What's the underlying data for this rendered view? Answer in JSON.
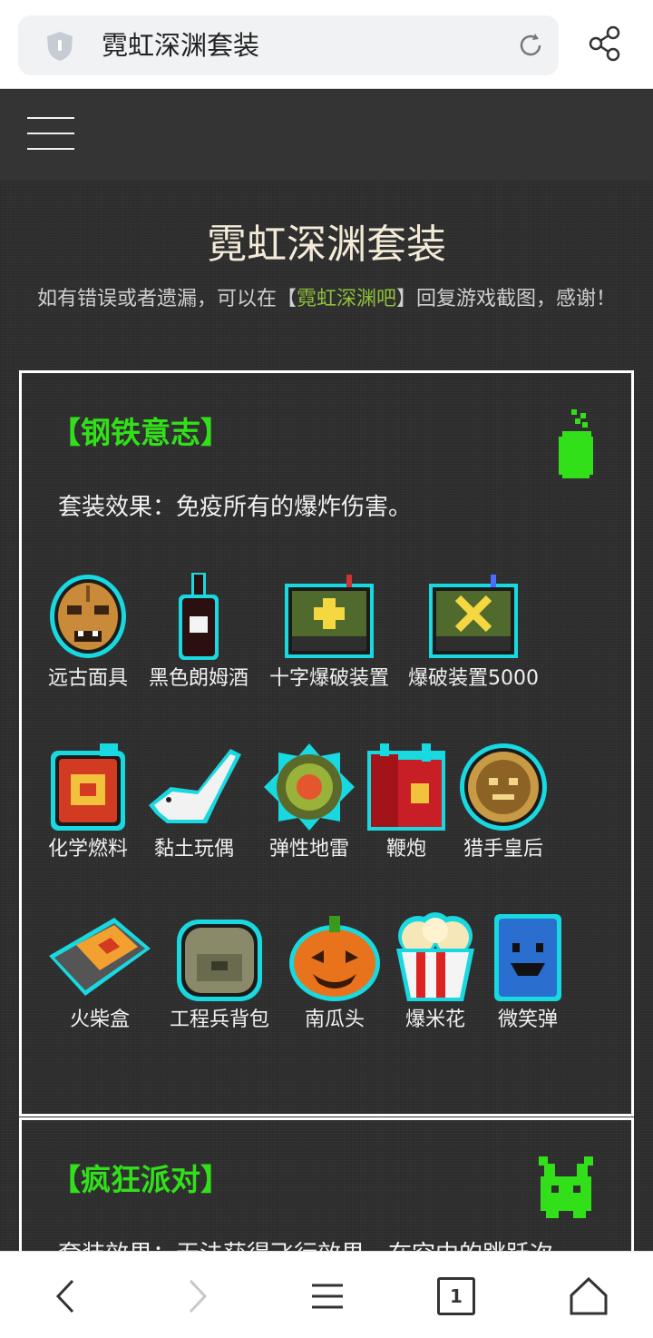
{
  "browser": {
    "url_title": "霓虹深渊套装",
    "icons": {
      "security": "shield-icon",
      "reload": "reload-icon",
      "share": "share-icon"
    }
  },
  "site_header": {
    "menu_icon": "hamburger-icon"
  },
  "page": {
    "title": "霓虹深渊套装",
    "notice_prefix": "如有错误或者遗漏，可以在【",
    "notice_link": "霓虹深渊吧",
    "notice_suffix": "】回复游戏截图，感谢！"
  },
  "sets": [
    {
      "title": "【钢铁意志】",
      "effect": "套装效果：免疫所有的爆炸伤害。",
      "items": [
        {
          "label": "远古面具"
        },
        {
          "label": "黑色朗姆酒"
        },
        {
          "label": "十字爆破装置"
        },
        {
          "label": "爆破装置5000"
        },
        {
          "label": "化学燃料"
        },
        {
          "label": "黏土玩偶"
        },
        {
          "label": "弹性地雷"
        },
        {
          "label": "鞭炮"
        },
        {
          "label": "猎手皇后"
        },
        {
          "label": "火柴盒"
        },
        {
          "label": "工程兵背包"
        },
        {
          "label": "南瓜头"
        },
        {
          "label": "爆米花"
        },
        {
          "label": "微笑弹"
        }
      ]
    },
    {
      "title": "【疯狂派对】",
      "effect": "套装效果：无法获得飞行效果，在空中的跳跃次"
    }
  ],
  "colors": {
    "accent_green": "#32e01a",
    "link_green": "#8fbf3a",
    "item_outline": "#18d8e0"
  },
  "bottom_nav": {
    "tab_count": "1"
  }
}
